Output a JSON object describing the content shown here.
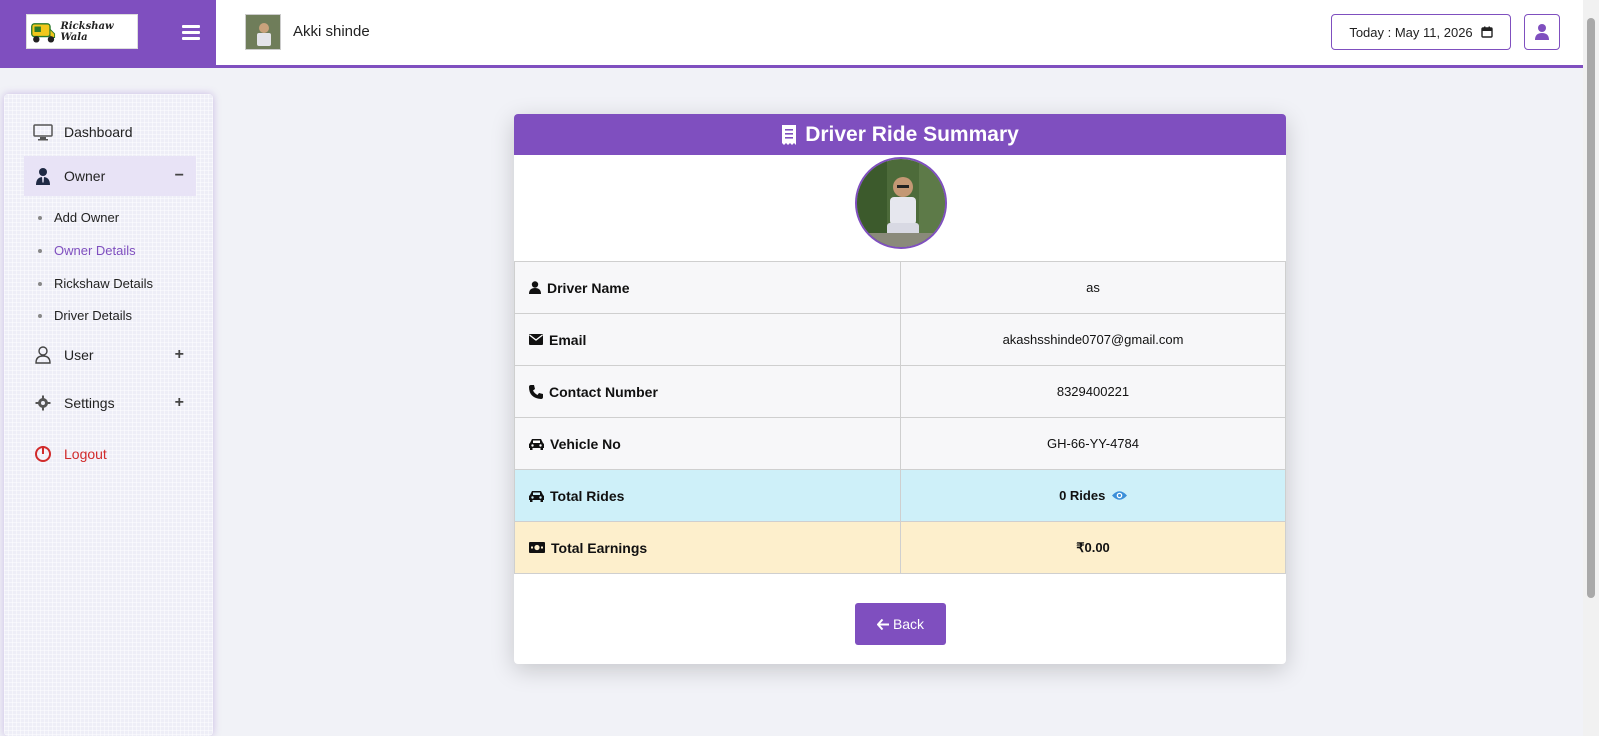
{
  "brand": {
    "logo_text": "Rickshaw Wala",
    "color": "#7f4fbf"
  },
  "header": {
    "user_name": "Akki shinde",
    "today_label": "Today : May 11, 2026"
  },
  "sidebar": {
    "items": [
      {
        "label": "Dashboard",
        "icon": "monitor-icon"
      },
      {
        "label": "Owner",
        "icon": "user-tie-icon",
        "toggle": "−"
      },
      {
        "label": "User",
        "icon": "user-outline-icon",
        "toggle": "+"
      },
      {
        "label": "Settings",
        "icon": "gear-icon",
        "toggle": "+"
      },
      {
        "label": "Logout",
        "icon": "power-icon"
      }
    ],
    "owner_sub": [
      "Add Owner",
      "Owner Details",
      "Rickshaw Details",
      "Driver Details"
    ]
  },
  "card": {
    "title": "Driver Ride Summary",
    "rows": [
      {
        "key": "Driver Name",
        "value": "as"
      },
      {
        "key": "Email",
        "value": "akashsshinde0707@gmail.com"
      },
      {
        "key": "Contact Number",
        "value": "8329400221"
      },
      {
        "key": "Vehicle No",
        "value": "GH-66-YY-4784"
      },
      {
        "key": "Total Rides",
        "value": "0 Rides"
      },
      {
        "key": "Total Earnings",
        "value": "₹0.00"
      }
    ],
    "back_label": "Back"
  }
}
